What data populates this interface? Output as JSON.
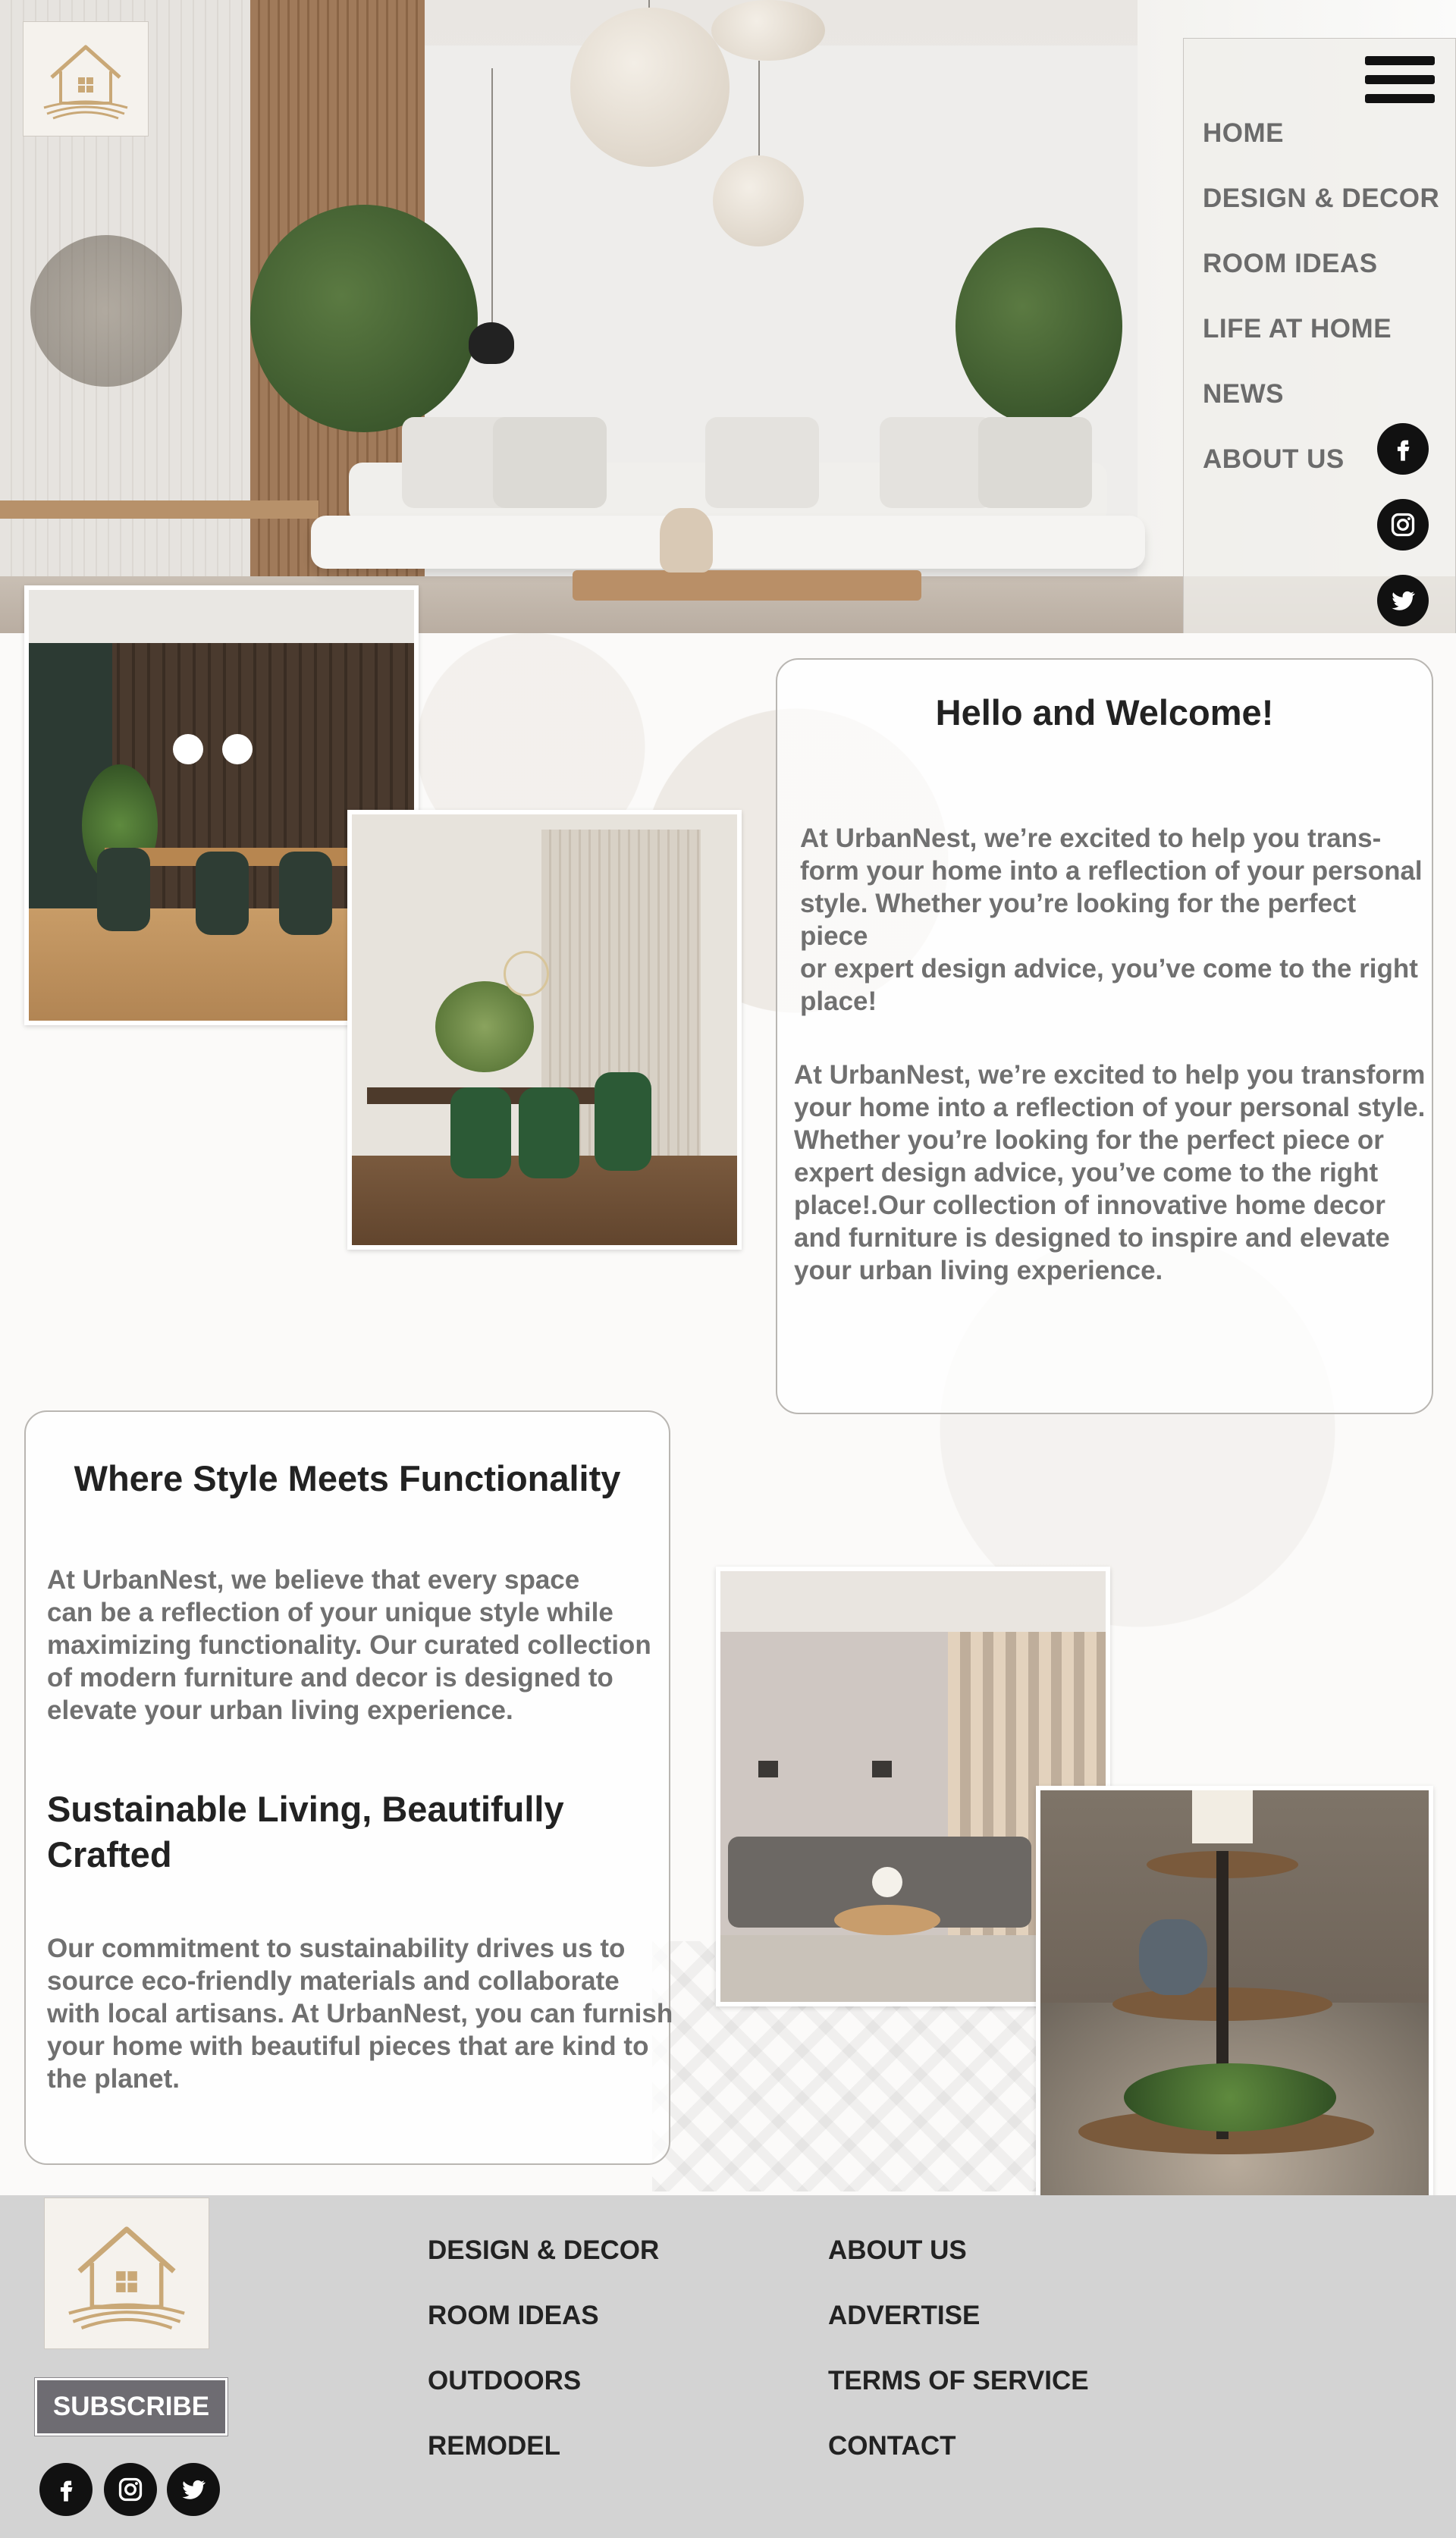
{
  "nav": {
    "menu_icon": "hamburger-menu-icon",
    "items": [
      "HOME",
      "DESIGN & DECOR",
      "ROOM IDEAS",
      "LIFE AT HOME",
      "NEWS",
      "ABOUT US"
    ],
    "social": [
      "facebook-icon",
      "instagram-icon",
      "twitter-icon"
    ]
  },
  "welcome": {
    "title": "Hello and Welcome!",
    "p1_line1": "At UrbanNest, we’re excited to help you trans-",
    "p1_line2": "form your home into a reflection of your personal",
    "p1_line3": "style. Whether you’re looking for the perfect piece",
    "p1_line4": "or expert design advice, you’ve come to the right",
    "p1_line5": "place!",
    "p2_line1": "At UrbanNest, we’re excited to help you transform",
    "p2_line2": "your home into a reflection of your personal style.",
    "p2_line3": "Whether you’re looking for the perfect piece or",
    "p2_line4": "expert design advice, you’ve come to the right",
    "p2_line5": "place!.Our collection of innovative home decor",
    "p2_line6": "and furniture is designed to inspire and elevate",
    "p2_line7": "your urban living experience."
  },
  "style": {
    "title": "Where Style Meets Functionality",
    "p1_line1": "At UrbanNest, we believe that every space",
    "p1_line2": "can be a reflection of your unique style while",
    "p1_line3": "maximizing functionality. Our curated collection",
    "p1_line4": "of modern furniture and decor is designed to",
    "p1_line5": "elevate your urban living experience.",
    "subtitle_line1": "Sustainable Living, Beautifully",
    "subtitle_line2": "Crafted",
    "p2_line1": "Our commitment to sustainability drives us to",
    "p2_line2": "source eco-friendly materials and collaborate",
    "p2_line3": "with local artisans. At UrbanNest, you can furnish",
    "p2_line4": "your home with beautiful pieces that are kind to",
    "p2_line5": "the planet."
  },
  "footer": {
    "col1": [
      "DESIGN & DECOR",
      "ROOM IDEAS",
      "OUTDOORS",
      "REMODEL"
    ],
    "col2": [
      "ABOUT US",
      "ADVERTISE",
      "TERMS OF SERVICE",
      "CONTACT"
    ],
    "subscribe": "SUBSCRIBE",
    "social": [
      "facebook-icon",
      "instagram-icon",
      "twitter-icon"
    ]
  },
  "colors": {
    "accent_gold": "#c9a877",
    "footer_bg": "#d3d3d3",
    "subscribe_bg": "#6e6c72",
    "nav_text": "#6b6b6b"
  }
}
